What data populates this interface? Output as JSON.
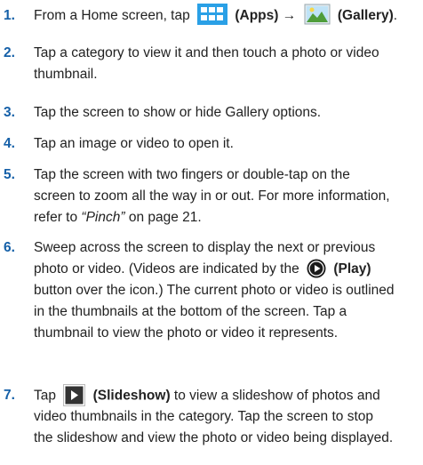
{
  "steps": [
    {
      "num": "1.",
      "lines": [
        {
          "a": "From a Home screen, tap",
          "apps_label": "(Apps)",
          "arrow": "→",
          "gallery_label": "(Gallery)",
          "end": "."
        }
      ]
    },
    {
      "num": "2.",
      "lines": [
        "Tap a category to view it and then touch a photo or video",
        "thumbnail."
      ]
    },
    {
      "num": "3.",
      "lines": [
        "Tap the screen to show or hide Gallery options."
      ]
    },
    {
      "num": "4.",
      "lines": [
        "Tap an image or video to open it."
      ]
    },
    {
      "num": "5.",
      "lines": [
        "Tap the screen with two fingers or double-tap on the",
        "screen to zoom all the way in or out. For more information,"
      ],
      "last": {
        "pre": "refer to ",
        "ref": "“Pinch”",
        "post": " on page 21."
      }
    },
    {
      "num": "6.",
      "line1": "Sweep across the screen to display the next or previous",
      "line2_pre": "photo or video. (Videos are indicated by the",
      "play_label": "(Play)",
      "lines_rest": [
        "button over the icon.) The current photo or video is outlined",
        "in the thumbnails at the bottom of the screen. Tap a",
        "thumbnail to view the photo or video it represents."
      ]
    },
    {
      "num": "7.",
      "line1_pre": "Tap",
      "slideshow_label": "(Slideshow)",
      "line1_post": " to view a slideshow of photos and",
      "lines_rest": [
        "video thumbnails in the category. Tap the screen to stop",
        "the slideshow and view the photo or video being displayed."
      ]
    }
  ],
  "colors": {
    "number": "#1560a8",
    "apps_icon": "#2aa0e6",
    "play_icon": "#1a1a1a"
  }
}
